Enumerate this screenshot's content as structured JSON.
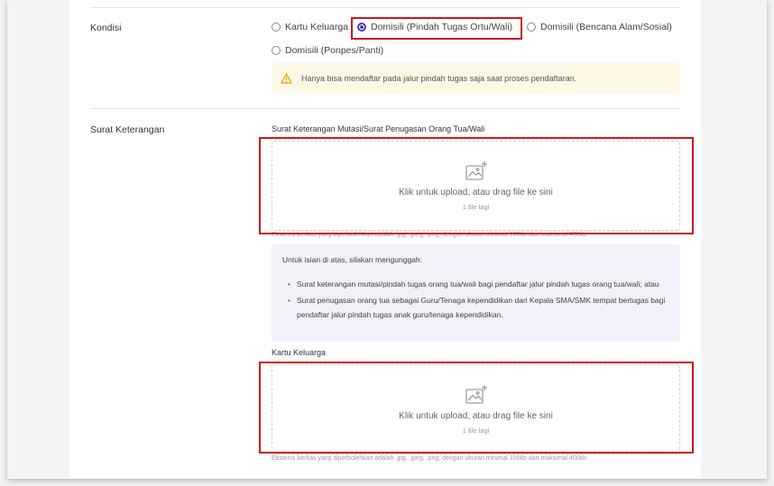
{
  "kondisi": {
    "label": "Kondisi",
    "options": [
      {
        "label": "Kartu Keluarga",
        "checked": false
      },
      {
        "label": "Domisili (Pindah Tugas Ortu/Wali)",
        "checked": true
      },
      {
        "label": "Domisili (Bencana Alam/Sosial)",
        "checked": false
      },
      {
        "label": "Domisili (Ponpes/Panti)",
        "checked": false
      }
    ],
    "warning": "Hanya bisa mendaftar pada jalur pindah tugas saja saat proses pendaftaran."
  },
  "surat_keterangan": {
    "label": "Surat Keterangan",
    "upload1": {
      "label": "Surat Keterangan Mutasi/Surat Penugasan Orang Tua/Wali",
      "main": "Klik untuk upload, atau drag file ke sini",
      "sub": "1 file lagi",
      "hint": "Ekstensi berkas yang diperbolehkan adalah .jpg, .jpeg, .png, dengan ukuran minimal 100kb dan maksimal 400kb"
    },
    "info": {
      "intro": "Untuk isian di atas, silakan mengunggah:",
      "items": [
        "Surat keterangan mutasi/pindah tugas orang tua/wali bagi pendaftar jalur pindah tugas orang tua/wali; atau",
        "Surat penugasan orang tua sebagai Guru/Tenaga kependidikan dari Kepala SMA/SMK tempat bertugas bagi pendaftar jalur pindah tugas anak guru/tenaga kependidikan."
      ]
    },
    "upload2": {
      "label": "Kartu Keluarga",
      "main": "Klik untuk upload, atau drag file ke sini",
      "sub": "1 file lagi",
      "hint": "Ekstensi berkas yang diperbolehkan adalah .jpg, .jpeg, .png, dengan ukuran minimal 100kb dan maksimal 400kb"
    }
  },
  "colors": {
    "accent": "#4a3fb5",
    "highlight": "#d0161c",
    "warning_bg": "#fdf8e6",
    "warning_icon": "#e0a400",
    "info_bg": "#f1f1f9"
  }
}
